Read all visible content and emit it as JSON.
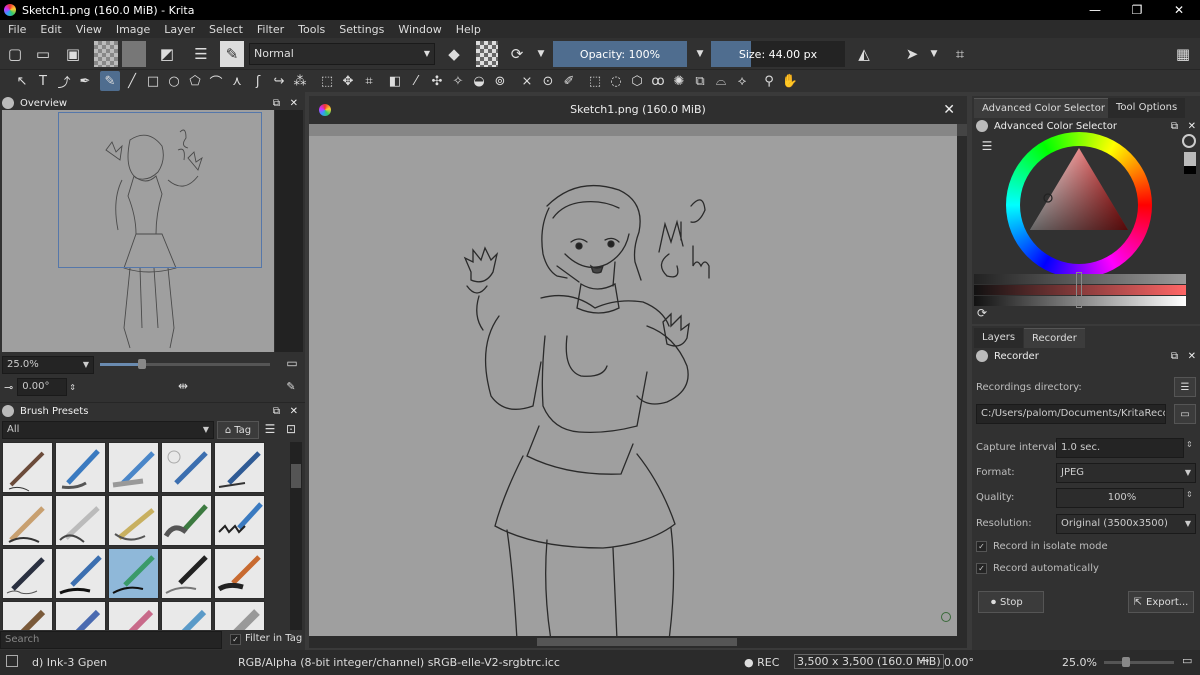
{
  "window": {
    "title": "Sketch1.png (160.0 MiB)  - Krita",
    "minimize_icon": "—",
    "maximize_icon": "❐",
    "close_icon": "✕"
  },
  "menu": [
    "File",
    "Edit",
    "View",
    "Image",
    "Layer",
    "Select",
    "Filter",
    "Tools",
    "Settings",
    "Window",
    "Help"
  ],
  "toolbar": {
    "blend_mode": "Normal",
    "opacity": "Opacity: 100%",
    "size": "Size: 44.00 px"
  },
  "overview": {
    "title": "Overview",
    "zoom": "25.0%",
    "rotation": "0.00°"
  },
  "brush_presets": {
    "title": "Brush Presets",
    "filter": "All",
    "tag_label": "Tag",
    "search_placeholder": "Search",
    "filter_in_tag": "Filter in Tag"
  },
  "canvas": {
    "title": "Sketch1.png (160.0 MiB)",
    "sketch_text": "WiP Comm"
  },
  "color_selector": {
    "tab_active": "Advanced Color Selector",
    "tab_other": "Tool Options",
    "title": "Advanced Color Selector",
    "accent_hue": "#d01818"
  },
  "recorder": {
    "tab_layers": "Layers",
    "tab_recorder": "Recorder",
    "title": "Recorder",
    "recordings_dir_label": "Recordings directory:",
    "recordings_dir_value": "C:/Users/palom/Documents/KritaRecorder",
    "capture_interval_label": "Capture interval:",
    "capture_interval_value": "1.0 sec.",
    "format_label": "Format:",
    "format_value": "JPEG",
    "quality_label": "Quality:",
    "quality_value": "100%",
    "resolution_label": "Resolution:",
    "resolution_value": "Original (3500x3500)",
    "isolate_label": "Record in isolate mode",
    "auto_label": "Record automatically",
    "stop_label": "Stop",
    "export_label": "Export..."
  },
  "status": {
    "brush": "d) Ink-3 Gpen",
    "color_model": "RGB/Alpha (8-bit integer/channel)  sRGB-elle-V2-srgbtrc.icc",
    "rec": "● REC",
    "dimensions": "3,500 x 3,500 (160.0 MiB)",
    "rotation": "0.00°",
    "zoom": "25.0%"
  }
}
